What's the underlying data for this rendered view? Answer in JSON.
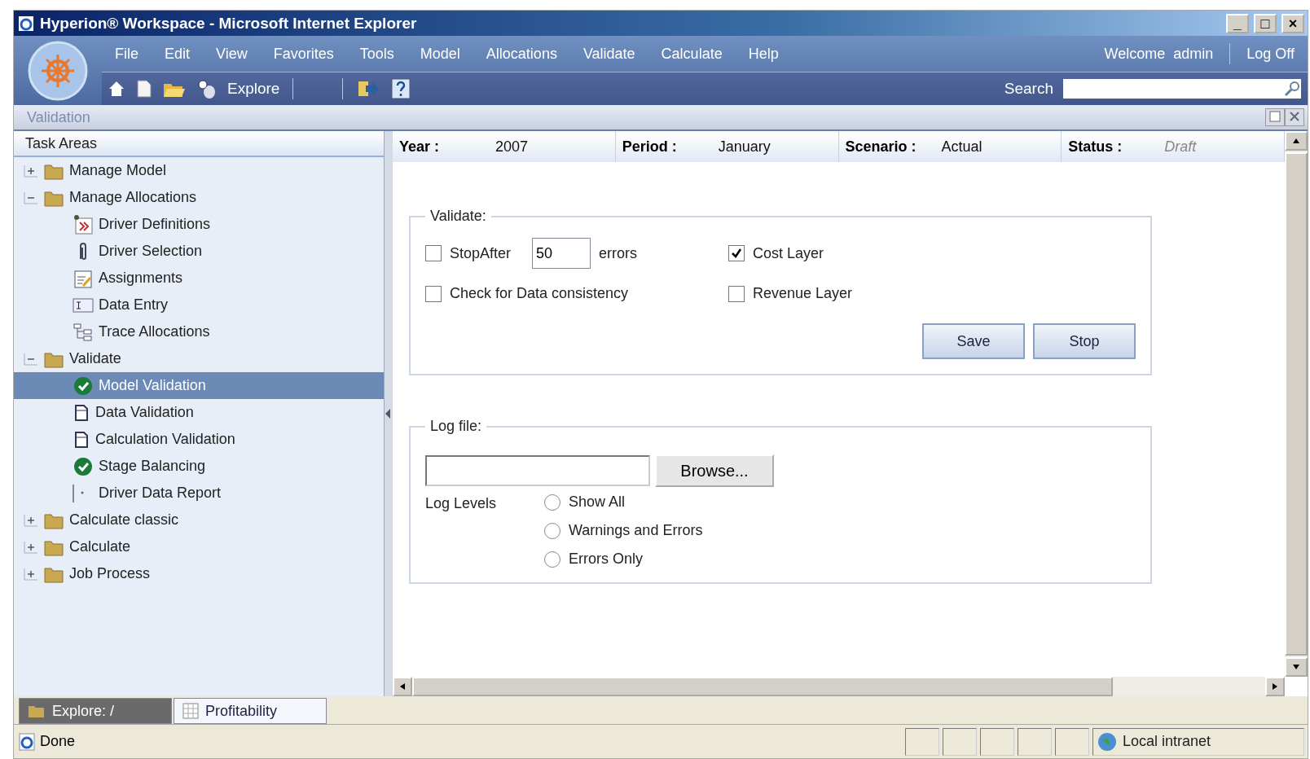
{
  "window": {
    "title": "Hyperion® Workspace - Microsoft Internet Explorer",
    "controls": [
      "_",
      "□",
      "×"
    ]
  },
  "menu": [
    "File",
    "Edit",
    "View",
    "Favorites",
    "Tools",
    "Model",
    "Allocations",
    "Validate",
    "Calculate",
    "Help"
  ],
  "user": {
    "welcome": "Welcome  admin",
    "logoff": "Log Off"
  },
  "toolbar": {
    "explore": "Explore",
    "search_label": "Search"
  },
  "panel_title": "Validation",
  "task_areas": {
    "title": "Task Areas",
    "items": [
      {
        "label": "Manage Model",
        "kind": "folder",
        "expanded": false,
        "selected": false
      },
      {
        "label": "Manage Allocations",
        "kind": "folder",
        "expanded": true,
        "selected": false,
        "children": [
          {
            "label": "Driver Definitions",
            "kind": "driver",
            "selected": false
          },
          {
            "label": "Driver Selection",
            "kind": "clip",
            "selected": false
          },
          {
            "label": "Assignments",
            "kind": "assign",
            "selected": false
          },
          {
            "label": "Data Entry",
            "kind": "entry",
            "selected": false
          },
          {
            "label": "Trace Allocations",
            "kind": "trace",
            "selected": false
          }
        ]
      },
      {
        "label": "Validate",
        "kind": "folder",
        "expanded": true,
        "selected": false,
        "children": [
          {
            "label": "Model Validation",
            "kind": "check",
            "selected": true
          },
          {
            "label": "Data Validation",
            "kind": "doc",
            "selected": false
          },
          {
            "label": "Calculation Validation",
            "kind": "doc",
            "selected": false
          },
          {
            "label": "Stage Balancing",
            "kind": "check",
            "selected": false
          },
          {
            "label": "Driver Data Report",
            "kind": "report",
            "selected": false
          }
        ]
      },
      {
        "label": "Calculate classic",
        "kind": "folder",
        "expanded": false,
        "selected": false
      },
      {
        "label": "Calculate",
        "kind": "folder",
        "expanded": false,
        "selected": false
      },
      {
        "label": "Job Process",
        "kind": "folder",
        "expanded": false,
        "selected": false
      }
    ]
  },
  "pov": [
    {
      "label": "Year :",
      "value": "2007",
      "italic": false
    },
    {
      "label": "Period :",
      "value": "January",
      "italic": false
    },
    {
      "label": "Scenario :",
      "value": "Actual",
      "italic": false
    },
    {
      "label": "Status :",
      "value": "Draft",
      "italic": true
    }
  ],
  "validate": {
    "legend": "Validate:",
    "stop_after": {
      "label": "StopAfter",
      "checked": false,
      "value": "50",
      "suffix": "errors"
    },
    "check_consistency": {
      "label": "Check for Data consistency",
      "checked": false
    },
    "cost_layer": {
      "label": "Cost Layer",
      "checked": true
    },
    "revenue_layer": {
      "label": "Revenue Layer",
      "checked": false
    },
    "buttons": [
      "Save",
      "Stop"
    ]
  },
  "log_file": {
    "legend": "Log file:",
    "browse": "Browse...",
    "levels_label": "Log Levels",
    "levels": [
      {
        "label": "Show All",
        "selected": false
      },
      {
        "label": "Warnings and Errors",
        "selected": false
      },
      {
        "label": "Errors Only",
        "selected": false
      }
    ]
  },
  "bottom_tabs": [
    {
      "label": "Explore: /",
      "selected": false
    },
    {
      "label": "Profitability",
      "selected": true
    }
  ],
  "status_bar": {
    "text": "Done",
    "zone": "Local intranet"
  }
}
